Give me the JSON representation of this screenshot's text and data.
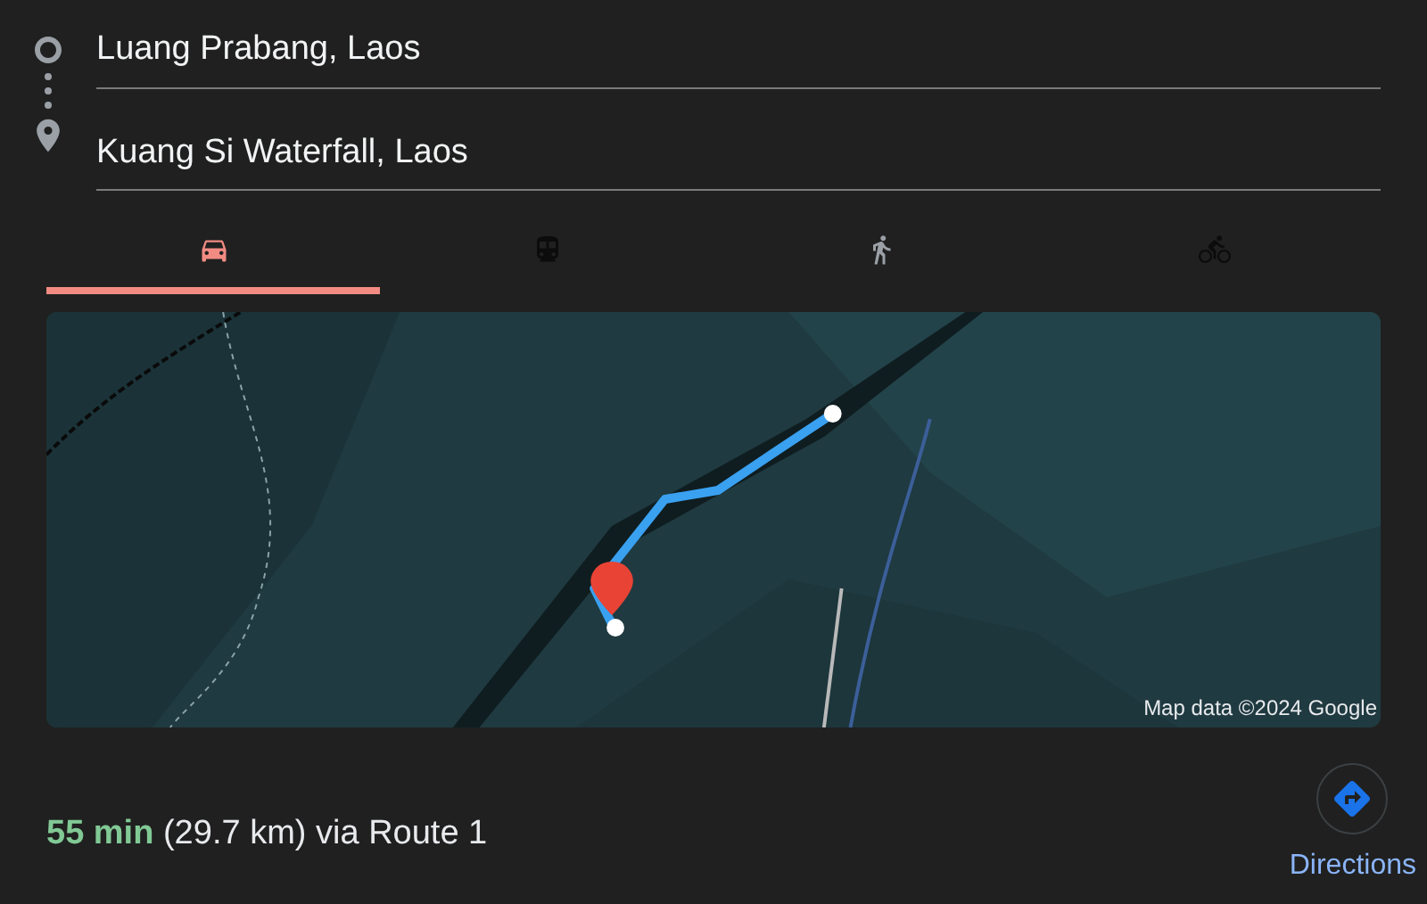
{
  "origin": {
    "value": "Luang Prabang, Laos"
  },
  "destination": {
    "value": "Kuang Si Waterfall, Laos"
  },
  "modes": [
    {
      "kind": "car",
      "selected": true,
      "disabled": false
    },
    {
      "kind": "transit",
      "selected": false,
      "disabled": true
    },
    {
      "kind": "walk",
      "selected": false,
      "disabled": false
    },
    {
      "kind": "bike",
      "selected": false,
      "disabled": true
    }
  ],
  "map": {
    "kind": "picture",
    "attribution": "Map data ©2024 Google"
  },
  "summary": "**55 min** (29.7 km) via Route 1",
  "directions_button": {
    "label": "Directions"
  }
}
